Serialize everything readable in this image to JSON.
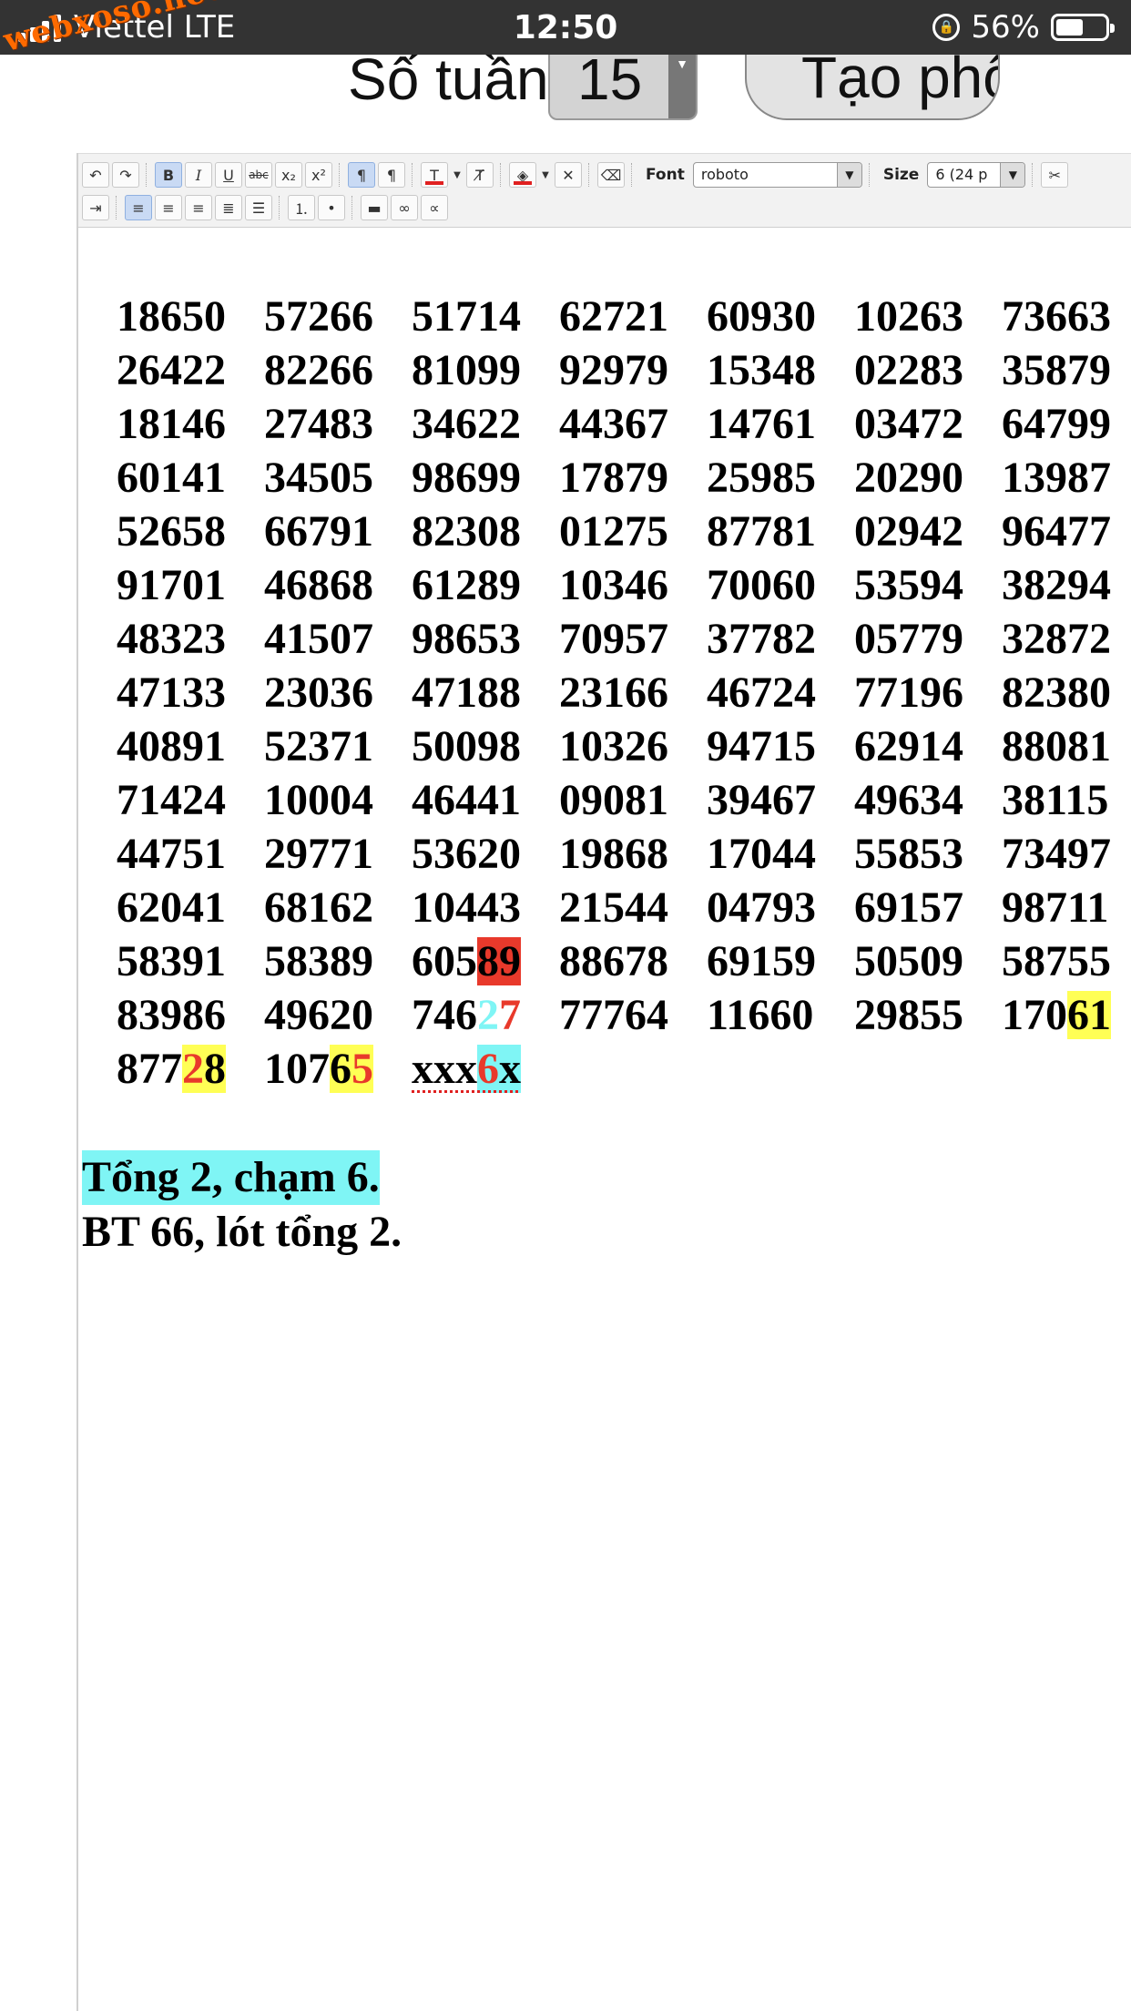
{
  "status_bar": {
    "carrier": "Viettel",
    "network": "LTE",
    "time": "12:50",
    "battery": "56%",
    "battery_level": 0.56
  },
  "watermark": "webxoso.net",
  "controls": {
    "weeks_label": "Số tuần",
    "weeks_value": "15",
    "create_button": "Tạo phô"
  },
  "toolbar": {
    "font_label": "Font",
    "font_value": "roboto",
    "size_label": "Size",
    "size_value": "6 (24 p",
    "icons": [
      "undo-icon",
      "redo-icon",
      "bold-icon",
      "italic-icon",
      "underline-icon",
      "strikethrough-icon",
      "subscript-icon",
      "superscript-icon",
      "ltr-icon",
      "rtl-icon",
      "text-color-icon",
      "remove-format-icon",
      "bg-color-icon",
      "remove-bg-icon",
      "eraser-icon",
      "indent-icon",
      "align-left-icon",
      "align-center-icon",
      "align-right-icon",
      "justify-icon",
      "justify-all-icon",
      "ordered-list-icon",
      "unordered-list-icon",
      "horizontal-rule-icon",
      "link-icon",
      "unlink-icon"
    ]
  },
  "numbers": [
    [
      "18650",
      "57266",
      "51714",
      "62721",
      "60930",
      "10263",
      "73663"
    ],
    [
      "26422",
      "82266",
      "81099",
      "92979",
      "15348",
      "02283",
      "35879"
    ],
    [
      "18146",
      "27483",
      "34622",
      "44367",
      "14761",
      "03472",
      "64799"
    ],
    [
      "60141",
      "34505",
      "98699",
      "17879",
      "25985",
      "20290",
      "13987"
    ],
    [
      "52658",
      "66791",
      "82308",
      "01275",
      "87781",
      "02942",
      "96477"
    ],
    [
      "91701",
      "46868",
      "61289",
      "10346",
      "70060",
      "53594",
      "38294"
    ],
    [
      "48323",
      "41507",
      "98653",
      "70957",
      "37782",
      "05779",
      "32872"
    ],
    [
      "47133",
      "23036",
      "47188",
      "23166",
      "46724",
      "77196",
      "82380"
    ],
    [
      "40891",
      "52371",
      "50098",
      "10326",
      "94715",
      "62914",
      "88081"
    ],
    [
      "71424",
      "10004",
      "46441",
      "09081",
      "39467",
      "49634",
      "38115"
    ],
    [
      "44751",
      "29771",
      "53620",
      "19868",
      "17044",
      "55853",
      "73497"
    ],
    [
      "62041",
      "68162",
      "10443",
      "21544",
      "04793",
      "69157",
      "98711"
    ],
    [
      "58391",
      "58389",
      "60589",
      "88678",
      "69159",
      "50509",
      "58755"
    ],
    [
      "83986",
      "49620",
      "74627",
      "77764",
      "11660",
      "29855",
      "17061"
    ],
    [
      "87728",
      "10765",
      "xxx6x"
    ]
  ],
  "special": {
    "r13c3": {
      "prefix": "605",
      "highlight": "89"
    },
    "r14c3": {
      "prefix": "746",
      "cyan": "2",
      "red": "7"
    },
    "r14c7": {
      "prefix": "170",
      "highlight": "61"
    },
    "r15c1": {
      "prefix": "877",
      "red": "2",
      "black": "8"
    },
    "r15c2": {
      "prefix": "107",
      "black": "6",
      "red": "5"
    },
    "r15c3": {
      "prefix": "xxx",
      "red": "6",
      "black": "x"
    }
  },
  "highlight_colors": {
    "red": "#e8392b",
    "yellow": "#ffff55",
    "cyan": "#7ff5f5"
  },
  "notes": {
    "line1": "Tổng 2, chạm 6.",
    "line2": "BT 66, lót tổng 2."
  }
}
